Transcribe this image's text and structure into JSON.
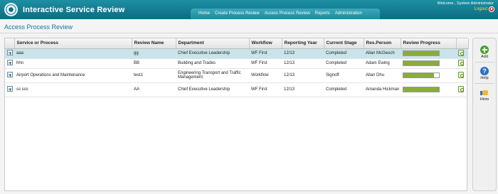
{
  "header": {
    "app_title": "Interactive Service Review",
    "welcome": "Welcome ,  System Administrator",
    "logout": "Logout",
    "nav": [
      "Home",
      "Create Process Review",
      "Access Process Review",
      "Reports",
      "Administration"
    ]
  },
  "page": {
    "title": "Access Process Review"
  },
  "table": {
    "columns": [
      "",
      "Service or Process",
      "Review Name",
      "Department",
      "Workflow",
      "Reporting Year",
      "Current Stage",
      "Res.Person",
      "Review Progress",
      ""
    ],
    "rows": [
      {
        "service": "aaa",
        "review_name": "gg",
        "department": "Chief Executive Leadership",
        "workflow": "WF First",
        "year": "12/13",
        "stage": "Completed",
        "person": "Allan McGeoch",
        "progress": 1.0
      },
      {
        "service": "hhn",
        "review_name": "BB",
        "department": "Building and Trades",
        "workflow": "WF First",
        "year": "12/13",
        "stage": "Completed",
        "person": "Adam Ewing",
        "progress": 1.0
      },
      {
        "service": "Airport Operations and Maintenance",
        "review_name": "test1",
        "department": "Engineering Transport and Traffic Management",
        "workflow": "Workflow",
        "year": "12/13",
        "stage": "Signoff",
        "person": "Allan Dhu",
        "progress": 0.85
      },
      {
        "service": "ss sss",
        "review_name": "AA",
        "department": "Chief Executive Leadership",
        "workflow": "WF First",
        "year": "12/13",
        "stage": "Completed",
        "person": "Amanda Hickman",
        "progress": 1.0
      }
    ]
  },
  "sidebar": {
    "add": "Add",
    "help": "Help",
    "hints": "Hints"
  },
  "colors": {
    "header": "#0b6d82",
    "progress": "#8aac3a",
    "selected_row": "#c9e4ea",
    "title": "#1178a0"
  }
}
